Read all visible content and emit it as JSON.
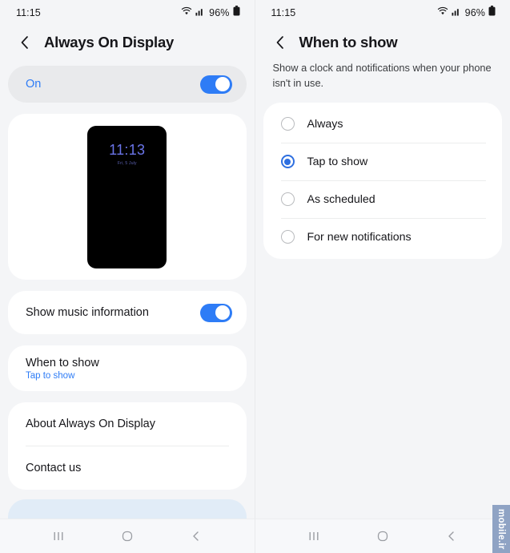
{
  "left": {
    "statusbar": {
      "time": "11:15",
      "battery_pct": "96%",
      "wifi_icon": "wifi-icon",
      "signal_icon": "signal-icon",
      "battery_icon": "battery-icon"
    },
    "header": {
      "title": "Always On Display",
      "back_icon": "back-chevron-icon"
    },
    "master_toggle": {
      "label": "On",
      "state": "on"
    },
    "preview": {
      "time": "11:13",
      "date": "Fri, 5 July"
    },
    "rows": {
      "music": {
        "label": "Show music information",
        "state": "on"
      },
      "when_to_show": {
        "label": "When to show",
        "sub": "Tap to show"
      },
      "about": {
        "label": "About Always On Display"
      },
      "contact": {
        "label": "Contact us"
      }
    },
    "navbar": {
      "recents_icon": "recents-icon",
      "home_icon": "home-icon",
      "back_icon": "back-chevron-icon"
    }
  },
  "right": {
    "statusbar": {
      "time": "11:15",
      "battery_pct": "96%",
      "wifi_icon": "wifi-icon",
      "signal_icon": "signal-icon",
      "battery_icon": "battery-icon"
    },
    "header": {
      "title": "When to show",
      "back_icon": "back-chevron-icon"
    },
    "description": "Show a clock and notifications when your phone isn't in use.",
    "options": [
      {
        "label": "Always",
        "selected": false
      },
      {
        "label": "Tap to show",
        "selected": true
      },
      {
        "label": "As scheduled",
        "selected": false
      },
      {
        "label": "For new notifications",
        "selected": false
      }
    ],
    "navbar": {
      "recents_icon": "recents-icon",
      "home_icon": "home-icon",
      "back_icon": "back-chevron-icon"
    }
  },
  "watermark": {
    "text": "mobile.ir"
  },
  "colors": {
    "accent": "#2e7cf6",
    "radio_selected": "#2e6fe0",
    "clock": "#6a74e8",
    "card": "#ffffff",
    "background": "#f4f5f7",
    "toggle_track": "#2e7cf6"
  }
}
